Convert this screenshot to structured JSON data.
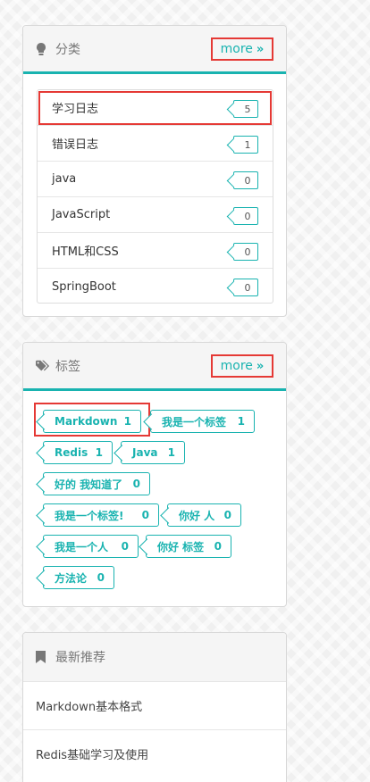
{
  "categories": {
    "title": "分类",
    "more": "more",
    "more_arrow": "»",
    "items": [
      {
        "label": "学习日志",
        "count": "5"
      },
      {
        "label": "错误日志",
        "count": "1"
      },
      {
        "label": "java",
        "count": "0"
      },
      {
        "label": "JavaScript",
        "count": "0"
      },
      {
        "label": "HTML和CSS",
        "count": "0"
      },
      {
        "label": "SpringBoot",
        "count": "0"
      }
    ]
  },
  "tags": {
    "title": "标签",
    "more": "more",
    "more_arrow": "»",
    "items": [
      {
        "label": "Markdown",
        "count": "1"
      },
      {
        "label": "我是一个标签",
        "count": "1"
      },
      {
        "label": "Redis",
        "count": "1"
      },
      {
        "label": "Java",
        "count": "1"
      },
      {
        "label": "好的 我知道了",
        "count": "0"
      },
      {
        "label": "我是一个标签!",
        "count": "0"
      },
      {
        "label": "你好 人",
        "count": "0"
      },
      {
        "label": "我是一个人",
        "count": "0"
      },
      {
        "label": "你好 标签",
        "count": "0"
      },
      {
        "label": "方法论",
        "count": "0"
      }
    ]
  },
  "recommend": {
    "title": "最新推荐",
    "items": [
      {
        "label": "Markdown基本格式"
      },
      {
        "label": "Redis基础学习及使用"
      }
    ]
  },
  "colors": {
    "accent": "#19b3b0",
    "highlight": "#e53935"
  },
  "icons": {
    "categories": "lightbulb-icon",
    "tags": "tags-icon",
    "recommend": "bookmark-icon",
    "more": "double-chevron-right-icon"
  }
}
